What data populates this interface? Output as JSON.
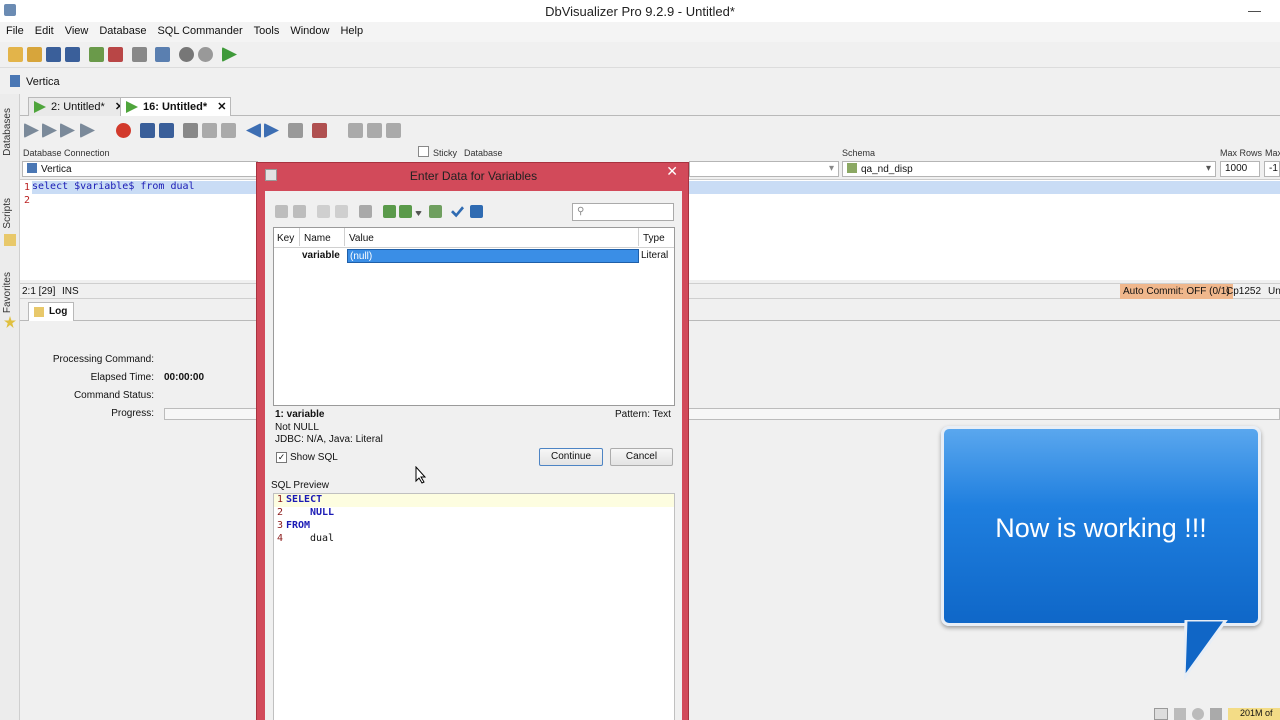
{
  "window": {
    "title": "DbVisualizer Pro 9.2.9 - Untitled*",
    "minimize": "—",
    "close": "✕"
  },
  "menu": [
    "File",
    "Edit",
    "View",
    "Database",
    "SQL Commander",
    "Tools",
    "Window",
    "Help"
  ],
  "connection_bar": {
    "label": "Vertica"
  },
  "left_tabs": {
    "databases": "Databases",
    "scripts": "Scripts",
    "favorites": "Favorites"
  },
  "tabs": [
    {
      "label": "2: Untitled*",
      "close": "✕"
    },
    {
      "label": "16: Untitled*",
      "close": "✕"
    }
  ],
  "headers": {
    "database_connection": "Database Connection",
    "sticky": "Sticky",
    "database": "Database",
    "schema": "Schema",
    "max_rows": "Max Rows",
    "max_chars": "Max"
  },
  "fields": {
    "connection_value": "Vertica",
    "schema_value": "qa_nd_disp",
    "max_rows_value": "1000",
    "max_chars_value": "-1"
  },
  "editor": {
    "line1_num": "1",
    "line1": "select $variable$ from dual",
    "line2_num": "2"
  },
  "editor_status": {
    "position": "2:1 [29]",
    "mode": "INS",
    "auto_commit": "Auto Commit: OFF (0/1)",
    "encoding": "Cp1252",
    "extra": "Un"
  },
  "log": {
    "tab": "Log",
    "processing_label": "Processing Command:",
    "elapsed_label": "Elapsed Time:",
    "elapsed_value": "00:00:00",
    "status_label": "Command Status:",
    "progress_label": "Progress:"
  },
  "dialog": {
    "title": "Enter Data for Variables",
    "close": "✕",
    "columns": {
      "key": "Key",
      "name": "Name",
      "value": "Value",
      "type": "Type"
    },
    "row": {
      "name": "variable",
      "value": "(null)",
      "type": "Literal"
    },
    "detail_title": "1: variable",
    "pattern": "Pattern: Text",
    "not_null": "Not NULL",
    "jdbc": "JDBC: N/A, Java: Literal",
    "show_sql": "Show SQL",
    "continue": "Continue",
    "cancel": "Cancel",
    "sql_preview_label": "SQL Preview",
    "sql_lines": [
      {
        "n": "1",
        "text": "SELECT"
      },
      {
        "n": "2",
        "text": "NULL"
      },
      {
        "n": "3",
        "text": "FROM"
      },
      {
        "n": "4",
        "text": "dual"
      }
    ]
  },
  "callout": {
    "text": "Now is working !!!"
  },
  "memory": "201M of"
}
